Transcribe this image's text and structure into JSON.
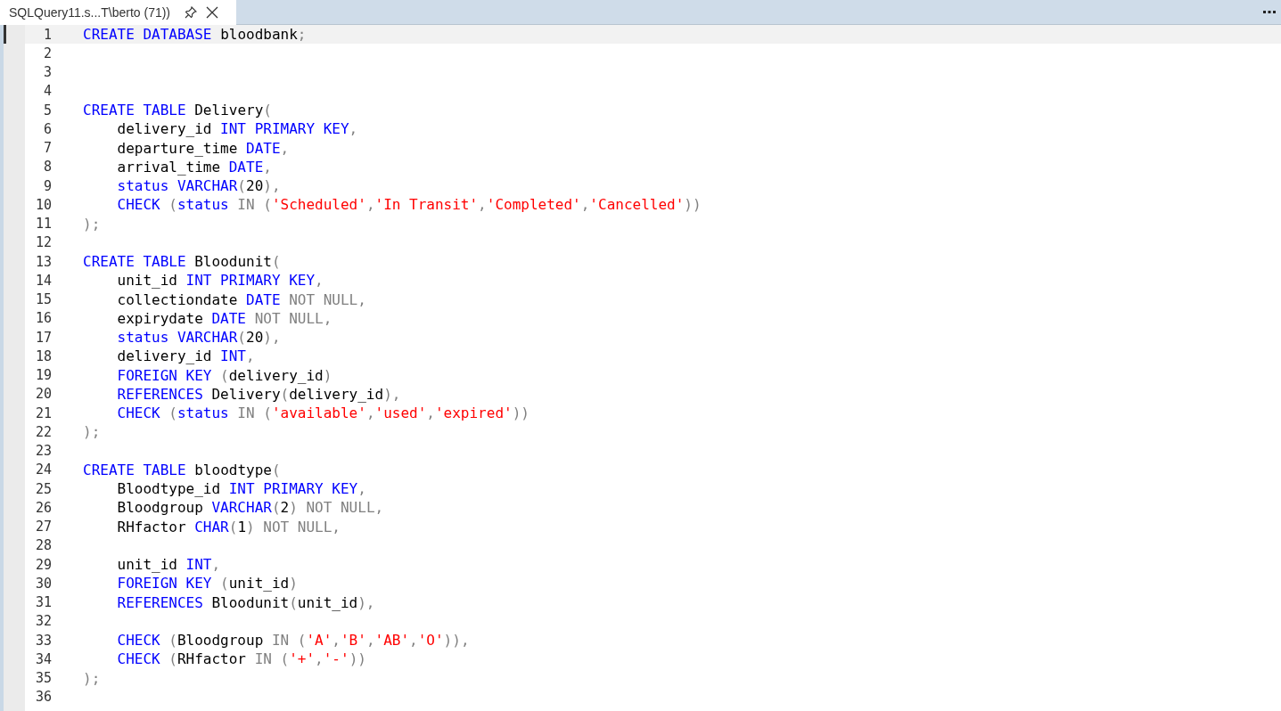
{
  "tab": {
    "title": "SQLQuery11.s...T\\berto (71))",
    "selected": true
  },
  "lines": [
    {
      "number": "1",
      "current": true,
      "indent": false,
      "tokens": [
        {
          "kind": "kw",
          "text": "CREATE DATABASE"
        },
        {
          "kind": "id",
          "text": " bloodbank"
        },
        {
          "kind": "op",
          "text": ";"
        }
      ]
    },
    {
      "number": "2",
      "current": false
    },
    {
      "number": "3",
      "current": false
    },
    {
      "number": "4",
      "current": false
    },
    {
      "number": "5",
      "current": false,
      "indent": false,
      "tokens": [
        {
          "kind": "kw",
          "text": "CREATE TABLE"
        },
        {
          "kind": "id",
          "text": " Delivery"
        },
        {
          "kind": "op",
          "text": "("
        }
      ]
    },
    {
      "number": "6",
      "current": false,
      "indent": true,
      "tokens": [
        {
          "kind": "id",
          "text": "delivery_id "
        },
        {
          "kind": "kw",
          "text": "INT PRIMARY KEY"
        },
        {
          "kind": "op",
          "text": ","
        }
      ]
    },
    {
      "number": "7",
      "current": false,
      "indent": true,
      "tokens": [
        {
          "kind": "id",
          "text": "departure_time "
        },
        {
          "kind": "kw",
          "text": "DATE"
        },
        {
          "kind": "op",
          "text": ","
        }
      ]
    },
    {
      "number": "8",
      "current": false,
      "indent": true,
      "tokens": [
        {
          "kind": "id",
          "text": "arrival_time "
        },
        {
          "kind": "kw",
          "text": "DATE"
        },
        {
          "kind": "op",
          "text": ","
        }
      ]
    },
    {
      "number": "9",
      "current": false,
      "indent": true,
      "tokens": [
        {
          "kind": "kw",
          "text": "status VARCHAR"
        },
        {
          "kind": "op",
          "text": "("
        },
        {
          "kind": "id",
          "text": "20"
        },
        {
          "kind": "op",
          "text": "),"
        }
      ]
    },
    {
      "number": "10",
      "current": false,
      "indent": true,
      "tokens": [
        {
          "kind": "kw",
          "text": "CHECK"
        },
        {
          "kind": "op",
          "text": " ("
        },
        {
          "kind": "kw",
          "text": "status"
        },
        {
          "kind": "op",
          "text": " IN ("
        },
        {
          "kind": "str",
          "text": "'Scheduled'"
        },
        {
          "kind": "op",
          "text": ","
        },
        {
          "kind": "str",
          "text": "'In Transit'"
        },
        {
          "kind": "op",
          "text": ","
        },
        {
          "kind": "str",
          "text": "'Completed'"
        },
        {
          "kind": "op",
          "text": ","
        },
        {
          "kind": "str",
          "text": "'Cancelled'"
        },
        {
          "kind": "op",
          "text": "))"
        }
      ]
    },
    {
      "number": "11",
      "current": false,
      "indent": false,
      "tokens": [
        {
          "kind": "op",
          "text": ");"
        }
      ]
    },
    {
      "number": "12",
      "current": false
    },
    {
      "number": "13",
      "current": false,
      "indent": false,
      "tokens": [
        {
          "kind": "kw",
          "text": "CREATE TABLE"
        },
        {
          "kind": "id",
          "text": " Bloodunit"
        },
        {
          "kind": "op",
          "text": "("
        }
      ]
    },
    {
      "number": "14",
      "current": false,
      "indent": true,
      "tokens": [
        {
          "kind": "id",
          "text": "unit_id "
        },
        {
          "kind": "kw",
          "text": "INT PRIMARY KEY"
        },
        {
          "kind": "op",
          "text": ","
        }
      ]
    },
    {
      "number": "15",
      "current": false,
      "indent": true,
      "tokens": [
        {
          "kind": "id",
          "text": "collectiondate "
        },
        {
          "kind": "kw",
          "text": "DATE"
        },
        {
          "kind": "op",
          "text": " NOT NULL,"
        }
      ]
    },
    {
      "number": "16",
      "current": false,
      "indent": true,
      "tokens": [
        {
          "kind": "id",
          "text": "expirydate "
        },
        {
          "kind": "kw",
          "text": "DATE"
        },
        {
          "kind": "op",
          "text": " NOT NULL,"
        }
      ]
    },
    {
      "number": "17",
      "current": false,
      "indent": true,
      "tokens": [
        {
          "kind": "kw",
          "text": "status VARCHAR"
        },
        {
          "kind": "op",
          "text": "("
        },
        {
          "kind": "id",
          "text": "20"
        },
        {
          "kind": "op",
          "text": "),"
        }
      ]
    },
    {
      "number": "18",
      "current": false,
      "indent": true,
      "tokens": [
        {
          "kind": "id",
          "text": "delivery_id "
        },
        {
          "kind": "kw",
          "text": "INT"
        },
        {
          "kind": "op",
          "text": ","
        }
      ]
    },
    {
      "number": "19",
      "current": false,
      "indent": true,
      "tokens": [
        {
          "kind": "kw",
          "text": "FOREIGN KEY"
        },
        {
          "kind": "op",
          "text": " ("
        },
        {
          "kind": "id",
          "text": "delivery_id"
        },
        {
          "kind": "op",
          "text": ")"
        }
      ]
    },
    {
      "number": "20",
      "current": false,
      "indent": true,
      "tokens": [
        {
          "kind": "kw",
          "text": "REFERENCES"
        },
        {
          "kind": "id",
          "text": " Delivery"
        },
        {
          "kind": "op",
          "text": "("
        },
        {
          "kind": "id",
          "text": "delivery_id"
        },
        {
          "kind": "op",
          "text": "),"
        }
      ]
    },
    {
      "number": "21",
      "current": false,
      "indent": true,
      "tokens": [
        {
          "kind": "kw",
          "text": "CHECK"
        },
        {
          "kind": "op",
          "text": " ("
        },
        {
          "kind": "kw",
          "text": "status"
        },
        {
          "kind": "op",
          "text": " IN ("
        },
        {
          "kind": "str",
          "text": "'available'"
        },
        {
          "kind": "op",
          "text": ","
        },
        {
          "kind": "str",
          "text": "'used'"
        },
        {
          "kind": "op",
          "text": ","
        },
        {
          "kind": "str",
          "text": "'expired'"
        },
        {
          "kind": "op",
          "text": "))"
        }
      ]
    },
    {
      "number": "22",
      "current": false,
      "indent": false,
      "tokens": [
        {
          "kind": "op",
          "text": ");"
        }
      ]
    },
    {
      "number": "23",
      "current": false
    },
    {
      "number": "24",
      "current": false,
      "indent": false,
      "tokens": [
        {
          "kind": "kw",
          "text": "CREATE TABLE"
        },
        {
          "kind": "id",
          "text": " bloodtype"
        },
        {
          "kind": "op",
          "text": "("
        }
      ]
    },
    {
      "number": "25",
      "current": false,
      "indent": true,
      "tokens": [
        {
          "kind": "id",
          "text": "Bloodtype_id "
        },
        {
          "kind": "kw",
          "text": "INT PRIMARY KEY"
        },
        {
          "kind": "op",
          "text": ","
        }
      ]
    },
    {
      "number": "26",
      "current": false,
      "indent": true,
      "tokens": [
        {
          "kind": "id",
          "text": "Bloodgroup "
        },
        {
          "kind": "kw",
          "text": "VARCHAR"
        },
        {
          "kind": "op",
          "text": "("
        },
        {
          "kind": "id",
          "text": "2"
        },
        {
          "kind": "op",
          "text": ") NOT NULL,"
        }
      ]
    },
    {
      "number": "27",
      "current": false,
      "indent": true,
      "tokens": [
        {
          "kind": "id",
          "text": "RHfactor "
        },
        {
          "kind": "kw",
          "text": "CHAR"
        },
        {
          "kind": "op",
          "text": "("
        },
        {
          "kind": "id",
          "text": "1"
        },
        {
          "kind": "op",
          "text": ") NOT NULL,"
        }
      ]
    },
    {
      "number": "28",
      "current": false
    },
    {
      "number": "29",
      "current": false,
      "indent": true,
      "tokens": [
        {
          "kind": "id",
          "text": "unit_id "
        },
        {
          "kind": "kw",
          "text": "INT"
        },
        {
          "kind": "op",
          "text": ","
        }
      ]
    },
    {
      "number": "30",
      "current": false,
      "indent": true,
      "tokens": [
        {
          "kind": "kw",
          "text": "FOREIGN KEY"
        },
        {
          "kind": "op",
          "text": " ("
        },
        {
          "kind": "id",
          "text": "unit_id"
        },
        {
          "kind": "op",
          "text": ")"
        }
      ]
    },
    {
      "number": "31",
      "current": false,
      "indent": true,
      "tokens": [
        {
          "kind": "kw",
          "text": "REFERENCES"
        },
        {
          "kind": "id",
          "text": " Bloodunit"
        },
        {
          "kind": "op",
          "text": "("
        },
        {
          "kind": "id",
          "text": "unit_id"
        },
        {
          "kind": "op",
          "text": "),"
        }
      ]
    },
    {
      "number": "32",
      "current": false
    },
    {
      "number": "33",
      "current": false,
      "indent": true,
      "tokens": [
        {
          "kind": "kw",
          "text": "CHECK"
        },
        {
          "kind": "op",
          "text": " ("
        },
        {
          "kind": "id",
          "text": "Bloodgroup"
        },
        {
          "kind": "op",
          "text": " IN ("
        },
        {
          "kind": "str",
          "text": "'A'"
        },
        {
          "kind": "op",
          "text": ","
        },
        {
          "kind": "str",
          "text": "'B'"
        },
        {
          "kind": "op",
          "text": ","
        },
        {
          "kind": "str",
          "text": "'AB'"
        },
        {
          "kind": "op",
          "text": ","
        },
        {
          "kind": "str",
          "text": "'O'"
        },
        {
          "kind": "op",
          "text": ")),"
        }
      ]
    },
    {
      "number": "34",
      "current": false,
      "indent": true,
      "tokens": [
        {
          "kind": "kw",
          "text": "CHECK"
        },
        {
          "kind": "op",
          "text": " ("
        },
        {
          "kind": "id",
          "text": "RHfactor"
        },
        {
          "kind": "op",
          "text": " IN ("
        },
        {
          "kind": "str",
          "text": "'+'"
        },
        {
          "kind": "op",
          "text": ","
        },
        {
          "kind": "str",
          "text": "'-'"
        },
        {
          "kind": "op",
          "text": "))"
        }
      ]
    },
    {
      "number": "35",
      "current": false,
      "indent": false,
      "tokens": [
        {
          "kind": "op",
          "text": ");"
        }
      ]
    },
    {
      "number": "36",
      "current": false
    }
  ]
}
